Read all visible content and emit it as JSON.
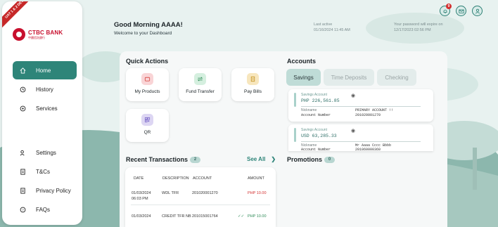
{
  "ribbon": "UAT 1 & 2 DEV",
  "brand": {
    "name": "CTBC BANK",
    "subname": "中國信託銀行"
  },
  "sidebar": {
    "items": [
      {
        "label": "Home",
        "icon": "home-icon"
      },
      {
        "label": "History",
        "icon": "history-icon"
      },
      {
        "label": "Services",
        "icon": "services-icon"
      },
      {
        "label": "Settings",
        "icon": "settings-icon"
      },
      {
        "label": "T&Cs",
        "icon": "document-icon"
      },
      {
        "label": "Privacy Policy",
        "icon": "document-icon"
      },
      {
        "label": "FAQs",
        "icon": "help-icon"
      }
    ]
  },
  "header": {
    "greeting": "Good Morning AAAA!",
    "subtitle": "Welcome to your Dashboard",
    "last_active_label": "Last active",
    "last_active_value": "01/16/2024 11:45 AM",
    "password_label": "Your password will expire on",
    "password_value": "12/17/2023 02:56 PM",
    "notification_count": "9"
  },
  "quick_actions": {
    "title": "Quick Actions",
    "items": [
      {
        "label": "My Products",
        "icon": "wallet-icon",
        "color": "#f9d4d6"
      },
      {
        "label": "Fund Transfer",
        "icon": "transfer-icon",
        "color": "#d5efdf"
      },
      {
        "label": "Pay Bills",
        "icon": "bill-icon",
        "color": "#f7e6bd"
      },
      {
        "label": "QR",
        "icon": "qr-icon",
        "color": "#ddd6f3"
      }
    ]
  },
  "accounts": {
    "title": "Accounts",
    "tabs": [
      "Savings",
      "Time Deposits",
      "Checking"
    ],
    "list": [
      {
        "type": "Savings Account",
        "balance": "PHP 226,561.85",
        "nickname_label": "Nickname",
        "nickname": "PRIMARY ACCOUNT !!",
        "number_label": "Account Number",
        "number": "201020001270"
      },
      {
        "type": "Savings Account",
        "balance": "USD 63,285.33",
        "nickname_label": "Nickname",
        "nickname": "Mr Aaaa Cccc Bbbb",
        "number_label": "Account Number",
        "number": "201060000360"
      }
    ]
  },
  "transactions": {
    "title": "Recent Transactions",
    "count": "2",
    "see_all": "See All",
    "columns": [
      "DATE",
      "DESCRIPTION",
      "ACCOUNT",
      "AMOUNT"
    ],
    "rows": [
      {
        "date": "01/03/2024",
        "time": "06:03 PM",
        "description": "WDL TFR",
        "account": "201020001270",
        "amount": "PHP 10.00",
        "type": "debit"
      },
      {
        "date": "01/03/2024",
        "time": "",
        "description": "CREDIT TFR NB",
        "account": "201015001764",
        "amount": "PHP 10.00",
        "type": "credit"
      }
    ]
  },
  "promotions": {
    "title": "Promotions",
    "count": "0"
  },
  "colors": {
    "accent": "#2e8579",
    "debit": "#d32f2f",
    "credit": "#2e8b57"
  }
}
